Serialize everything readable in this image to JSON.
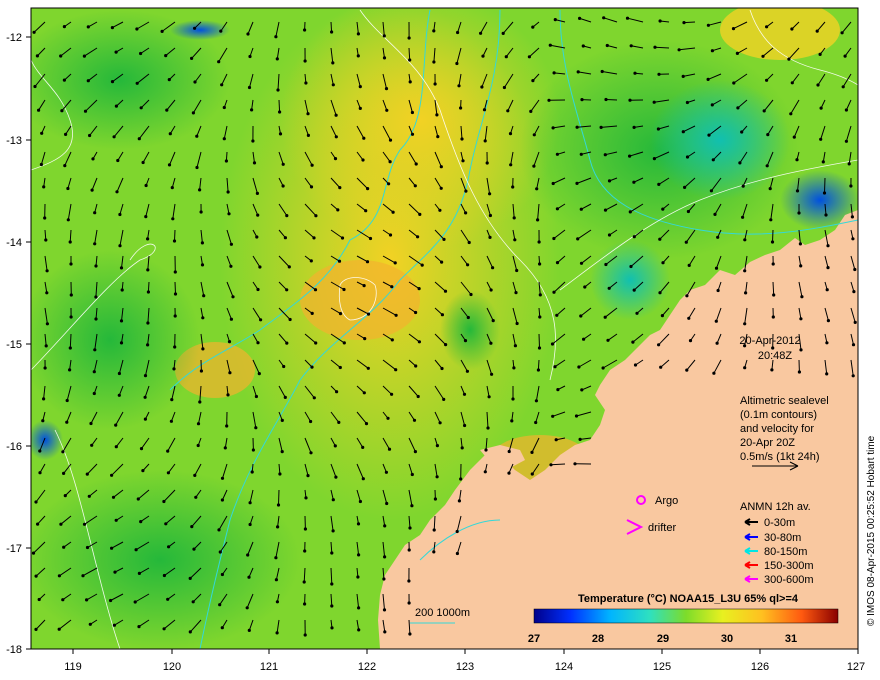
{
  "map": {
    "date_label": "20-Apr-2012",
    "time_label": "20:48Z",
    "lon_ticks": [
      "119",
      "120",
      "121",
      "122",
      "123",
      "124",
      "125",
      "126",
      "127"
    ],
    "lat_ticks": [
      "-12",
      "-13",
      "-14",
      "-15",
      "-16",
      "-17",
      "-18"
    ],
    "altimetric_note": {
      "line1": "Altimetric sealevel",
      "line2": "(0.1m contours)",
      "line3": "and velocity for",
      "line4": "20-Apr 20Z",
      "line5": "0.5m/s (1kt 24h)"
    },
    "argo_label": "Argo",
    "drifter_label": "drifter",
    "anmn": {
      "title": "ANMN 12h av.",
      "items": [
        {
          "label": "0-30m",
          "color": "#000000"
        },
        {
          "label": "30-80m",
          "color": "#0000ff"
        },
        {
          "label": "80-150m",
          "color": "#00e5e5"
        },
        {
          "label": "150-300m",
          "color": "#ff0000"
        },
        {
          "label": "300-600m",
          "color": "#ff00ff"
        }
      ]
    },
    "depth_legend": "200  1000m",
    "colorbar": {
      "title": "Temperature (°C) NOAA15_L3U 65% ql>=4",
      "ticks": [
        "27",
        "28",
        "29",
        "30",
        "31"
      ]
    },
    "credit": "© IMOS 08-Apr-2015 00:25:52 Hobart time",
    "colors": {
      "land": "#f9c8a0",
      "isobath": "#34d8d8",
      "sealevel_contour": "#ffffff",
      "argo": "#ff00ff"
    }
  }
}
